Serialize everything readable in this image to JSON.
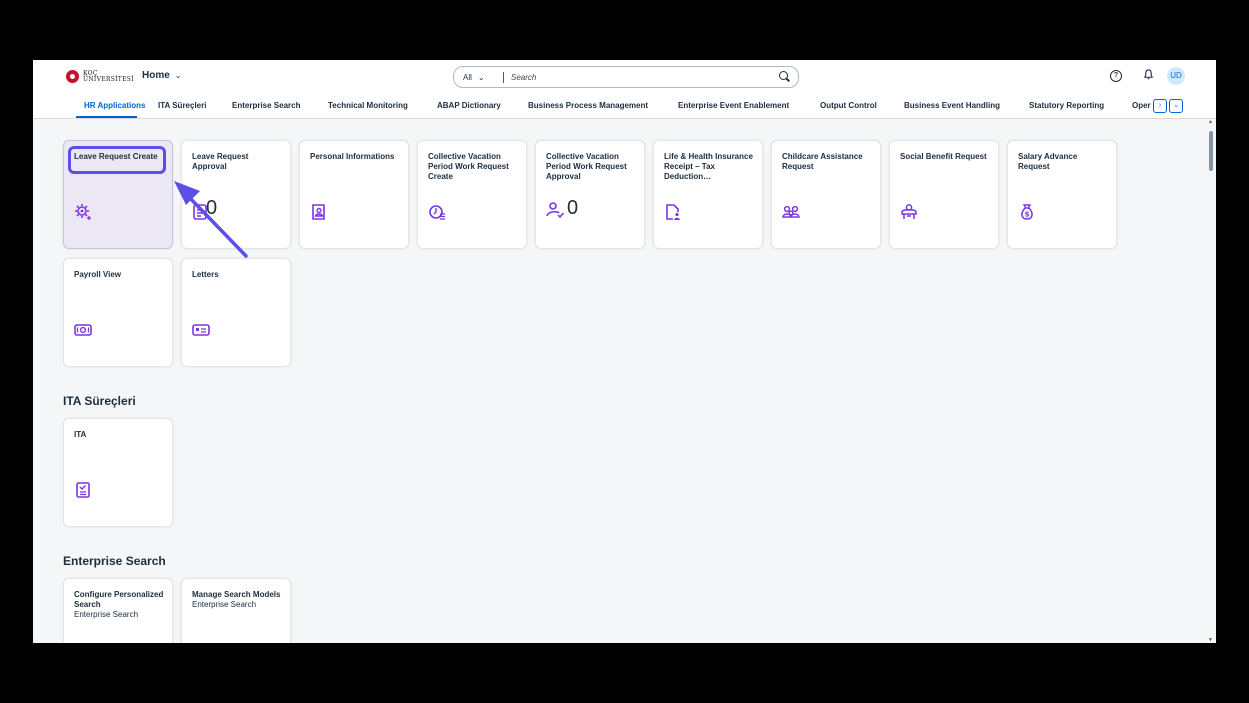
{
  "shell": {
    "logo_text_line1": "KOÇ",
    "logo_text_line2": "ÜNİVERSİTESİ",
    "home_label": "Home",
    "search_scope": "All",
    "search_placeholder": "Search",
    "avatar_initials": "UD"
  },
  "tabs": [
    {
      "label": "HR Applications",
      "active": true
    },
    {
      "label": "ITA Süreçleri"
    },
    {
      "label": "Enterprise Search"
    },
    {
      "label": "Technical Monitoring"
    },
    {
      "label": "ABAP Dictionary"
    },
    {
      "label": "Business Process Management"
    },
    {
      "label": "Enterprise Event Enablement"
    },
    {
      "label": "Output Control"
    },
    {
      "label": "Business Event Handling"
    },
    {
      "label": "Statutory Reporting"
    },
    {
      "label": "Oper"
    }
  ],
  "sections": {
    "ita_title": "ITA Süreçleri",
    "enterprise_title": "Enterprise Search"
  },
  "hr_tiles": [
    {
      "title": "Leave Request Create",
      "icon": "settings-gear-icon"
    },
    {
      "title": "Leave Request Approval",
      "icon": "document-list-icon",
      "count": "0"
    },
    {
      "title": "Personal Informations",
      "icon": "personal-card-icon"
    },
    {
      "title": "Collective Vacation Period Work Request Create",
      "icon": "clock-list-icon"
    },
    {
      "title": "Collective Vacation Period Work Request Approval",
      "icon": "person-check-icon",
      "count": "0"
    },
    {
      "title": "Life & Health Insurance Receipt – Tax Deduction…",
      "icon": "document-people-icon"
    },
    {
      "title": "Childcare Assistance Request",
      "icon": "family-icon"
    },
    {
      "title": "Social Benefit Request",
      "icon": "group-icon"
    },
    {
      "title": "Salary Advance Request",
      "icon": "money-bag-icon"
    },
    {
      "title": "Payroll View",
      "icon": "money-icon"
    },
    {
      "title": "Letters",
      "icon": "id-card-icon"
    }
  ],
  "ita_tiles": [
    {
      "title": "ITA",
      "icon": "checklist-icon"
    }
  ],
  "enterprise_tiles": [
    {
      "title": "Configure Personalized Search",
      "subtitle": "Enterprise Search"
    },
    {
      "title": "Manage Search Models",
      "subtitle": "Enterprise Search"
    }
  ],
  "colors": {
    "accent": "#0064d9",
    "icon": "#7b35e0",
    "highlight": "#5b4fe6"
  }
}
